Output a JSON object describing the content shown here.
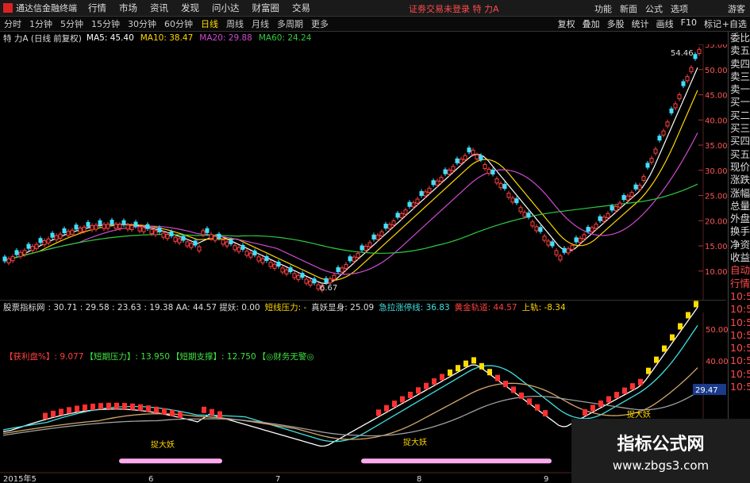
{
  "app": {
    "title": "通达信金融终端"
  },
  "menu": [
    "行情",
    "市场",
    "资讯",
    "发现",
    "问小达",
    "财富圈",
    "交易"
  ],
  "login_status": "证劵交易未登录  特 力A",
  "right_menu": [
    "功能",
    "新面",
    "公式",
    "选项"
  ],
  "periods": [
    "分时",
    "1分钟",
    "5分钟",
    "15分钟",
    "30分钟",
    "60分钟",
    "日线",
    "周线",
    "月线",
    "多周期",
    "更多"
  ],
  "active_period": "日线",
  "toolbar": [
    "复权",
    "叠加",
    "多股",
    "统计",
    "画线",
    "F10",
    "标记"
  ],
  "autoselect": "+自选",
  "guest": "游客",
  "stock_info": {
    "name": "特 力A (日线 前复权)",
    "ma5": "MA5: 45.40",
    "ma10": "MA10: 38.47",
    "ma20": "MA20: 29.88",
    "ma60": "MA60: 24.24",
    "colors": {
      "ma5": "#ffffff",
      "ma10": "#ffd700",
      "ma20": "#d04ad0",
      "ma60": "#2ecc40"
    }
  },
  "chart_labels": {
    "high": "54.46",
    "low": "6.67"
  },
  "price_axis": [
    "55.00",
    "50.00",
    "45.00",
    "40.00",
    "35.00",
    "30.00",
    "25.00",
    "20.00",
    "15.00",
    "10.00"
  ],
  "indicator": {
    "name": "股票指标网",
    "values": ": 30.71  : 29.58  : 23.63  : 19.38  AA: 44.57  提妖: 0.00",
    "pressure": "短线压力: -",
    "zhenyao": "真妖显身: 25.09",
    "jila": "急拉涨停线: 36.83",
    "gold": "黄金轨道: 44.57",
    "upper": "上轨: -8.34"
  },
  "indicator2": {
    "profit": "【获利盘%】: 9.077",
    "pressure": "【短期压力】: 13.950",
    "support": "【短期支撑】: 12.750",
    "finance": "【◎财务无警◎"
  },
  "ind_axis": [
    "50.00",
    "40.00"
  ],
  "ind_value": "29.47",
  "tags": [
    "捉大妖",
    "捉大妖",
    "捉大妖"
  ],
  "x_axis": [
    "2015年5",
    "6",
    "7",
    "8",
    "9"
  ],
  "sidebar": [
    "委比",
    "卖五",
    "卖四",
    "卖三",
    "卖一",
    "买一",
    "买二",
    "买三",
    "买四",
    "买五",
    "现价",
    "涨跌",
    "涨幅",
    "总量",
    "外盘",
    "换手",
    "净资",
    "收益"
  ],
  "sidebar2": [
    "自动",
    "行情",
    "10:5",
    "10:5",
    "10:5",
    "10:5",
    "10:5",
    "10:5",
    "10:5",
    "10:5"
  ],
  "watermark": {
    "title": "指标公式网",
    "url": "www.zbgs3.com"
  }
}
